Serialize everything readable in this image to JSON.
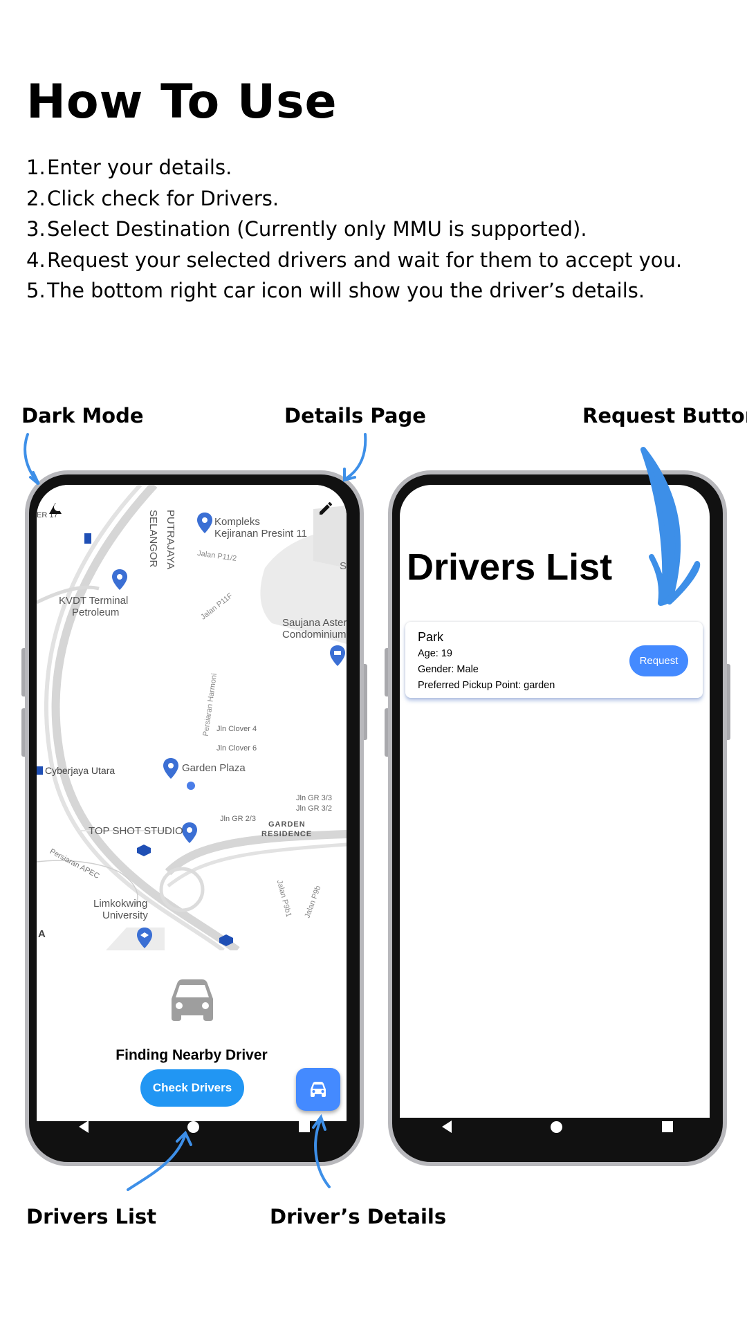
{
  "title": "How To Use",
  "steps": [
    {
      "num": "1.",
      "text": "Enter your details."
    },
    {
      "num": "2.",
      "text": "Click check for Drivers."
    },
    {
      "num": "3.",
      "text": "Select Destination (Currently only MMU is supported)."
    },
    {
      "num": "4.",
      "text": "Request your selected drivers and wait for them to accept you."
    },
    {
      "num": "5.",
      "text": "The bottom right car icon will show you the driver’s details."
    }
  ],
  "callouts": {
    "dark_mode": "Dark Mode",
    "details_page": "Details Page",
    "request_button": "Request Button",
    "drivers_list": "Drivers List",
    "drivers_details": "Driver’s Details"
  },
  "colors": {
    "accent": "#2196f3",
    "fab": "#448aff",
    "arrow": "#3d8fe8",
    "pin": "#3b6fd4"
  },
  "map": {
    "labels": {
      "er17": "ER 17",
      "selangor": "SELANGOR",
      "putrajaya": "PUTRAJAYA",
      "kompleks": "Kompleks",
      "kejiranan": "Kejiranan Presint 11",
      "jalan_p11_2": "Jalan P11/2",
      "s": "S",
      "kvdt": "KVDT Terminal",
      "petroleum": "Petroleum",
      "jalan_p11f": "Jalan P11F",
      "saujana": "Saujana Aster",
      "condominium": "Condominium",
      "persiaran_harmoni": "Persiaran Harmoni",
      "clover4": "Jln Clover 4",
      "clover6": "Jln Clover 6",
      "cyberjaya": "Cyberjaya Utara",
      "garden_plaza": "Garden Plaza",
      "gr33": "Jln GR 3/3",
      "gr32": "Jln GR 3/2",
      "gr23": "Jln GR 2/3",
      "garden": "GARDEN",
      "residence": "RESIDENCE",
      "topshot": "TOP SHOT STUDIO",
      "persiaran_apec": "Persiaran APEC",
      "limkokwing": "Limkokwing",
      "university": "University",
      "jalan_p9b1": "Jalan P9b1",
      "jalan_p9b": "Jalan P9b",
      "a": "A"
    }
  },
  "home_screen": {
    "status": "Finding Nearby Driver",
    "check_button": "Check Drivers",
    "icons": [
      "dark-mode-icon",
      "edit-icon",
      "car-icon",
      "car-fab-icon"
    ]
  },
  "drivers_screen": {
    "title": "Drivers List",
    "drivers": [
      {
        "name": "Park",
        "age": "Age: 19",
        "gender": "Gender: Male",
        "pickup": "Preferred Pickup Point: garden",
        "button": "Request"
      }
    ]
  }
}
